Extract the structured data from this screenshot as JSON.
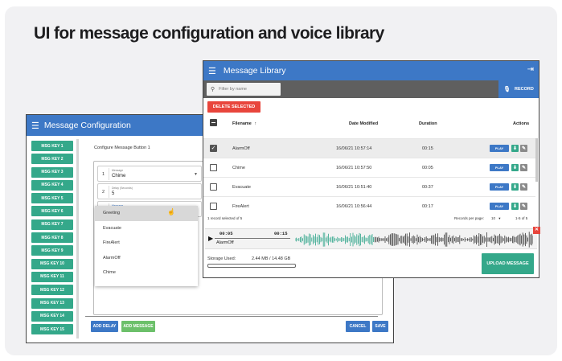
{
  "page": {
    "title": "UI for message configuration and voice library"
  },
  "config": {
    "title": "Message Configuration",
    "keys": [
      "MSG KEY 1",
      "MSG KEY 2",
      "MSG KEY 3",
      "MSG KEY 4",
      "MSG KEY 5",
      "MSG KEY 6",
      "MSG KEY 7",
      "MSG KEY 8",
      "MSG KEY 9",
      "MSG KEY 10",
      "MSG KEY 11",
      "MSG KEY 12",
      "MSG KEY 13",
      "MSG KEY 14",
      "MSG KEY 15"
    ],
    "heading": "Configure Message Button 1",
    "rows": [
      {
        "num": "1",
        "label": "Message",
        "value": "Chime"
      },
      {
        "num": "2",
        "label": "Delay (Seconds)",
        "value": "5"
      },
      {
        "num": "3",
        "label": "Message",
        "value": ""
      }
    ],
    "options": [
      "Greeting",
      "Evacuate",
      "FireAlert",
      "AlarmOff",
      "Chime"
    ],
    "buttons": {
      "add_delay": "ADD DELAY",
      "add_message": "ADD MESSAGE",
      "cancel": "CANCEL",
      "save": "SAVE"
    },
    "colors": {
      "header": "#3d78c6",
      "key": "#34a88a"
    }
  },
  "library": {
    "title": "Message Library",
    "search_placeholder": "Filter by name",
    "record_label": "RECORD",
    "delete_label": "DELETE SELECTED",
    "columns": {
      "filename": "Filename",
      "sort": "↑",
      "date": "Date Modified",
      "duration": "Duration",
      "actions": "Actions"
    },
    "rows": [
      {
        "name": "AlarmOff",
        "date": "16/06/21 10:57:14",
        "duration": "00:15",
        "selected": true
      },
      {
        "name": "Chime",
        "date": "16/06/21 10:57:50",
        "duration": "00:05",
        "selected": false
      },
      {
        "name": "Evacuate",
        "date": "16/06/21 10:51:40",
        "duration": "00:37",
        "selected": false
      },
      {
        "name": "FireAlert",
        "date": "16/06/21 10:56:44",
        "duration": "00:17",
        "selected": false
      }
    ],
    "action_labels": {
      "play": "PLAY",
      "download": "⬇",
      "edit": "✎"
    },
    "footer": {
      "selected": "1 record selected of 5",
      "rpp_label": "Records per page:",
      "rpp_value": "10",
      "range": "1-5 of 5"
    },
    "player": {
      "current": "00:05",
      "total": "00:15",
      "filename": "AlarmOff"
    },
    "storage": {
      "label": "Storage Used:",
      "value": "2.44 MB / 14.48 GB",
      "fraction": 0.0002
    },
    "upload_label": "UPLOAD MESSAGE",
    "colors": {
      "header": "#3d78c6",
      "toolbar": "#5f5f5f",
      "delete": "#e8453c",
      "upload": "#34a88a",
      "play": "#3d78c6",
      "download": "#34a88a",
      "edit": "#8a8a8a",
      "wave": "#2fa58a"
    }
  }
}
